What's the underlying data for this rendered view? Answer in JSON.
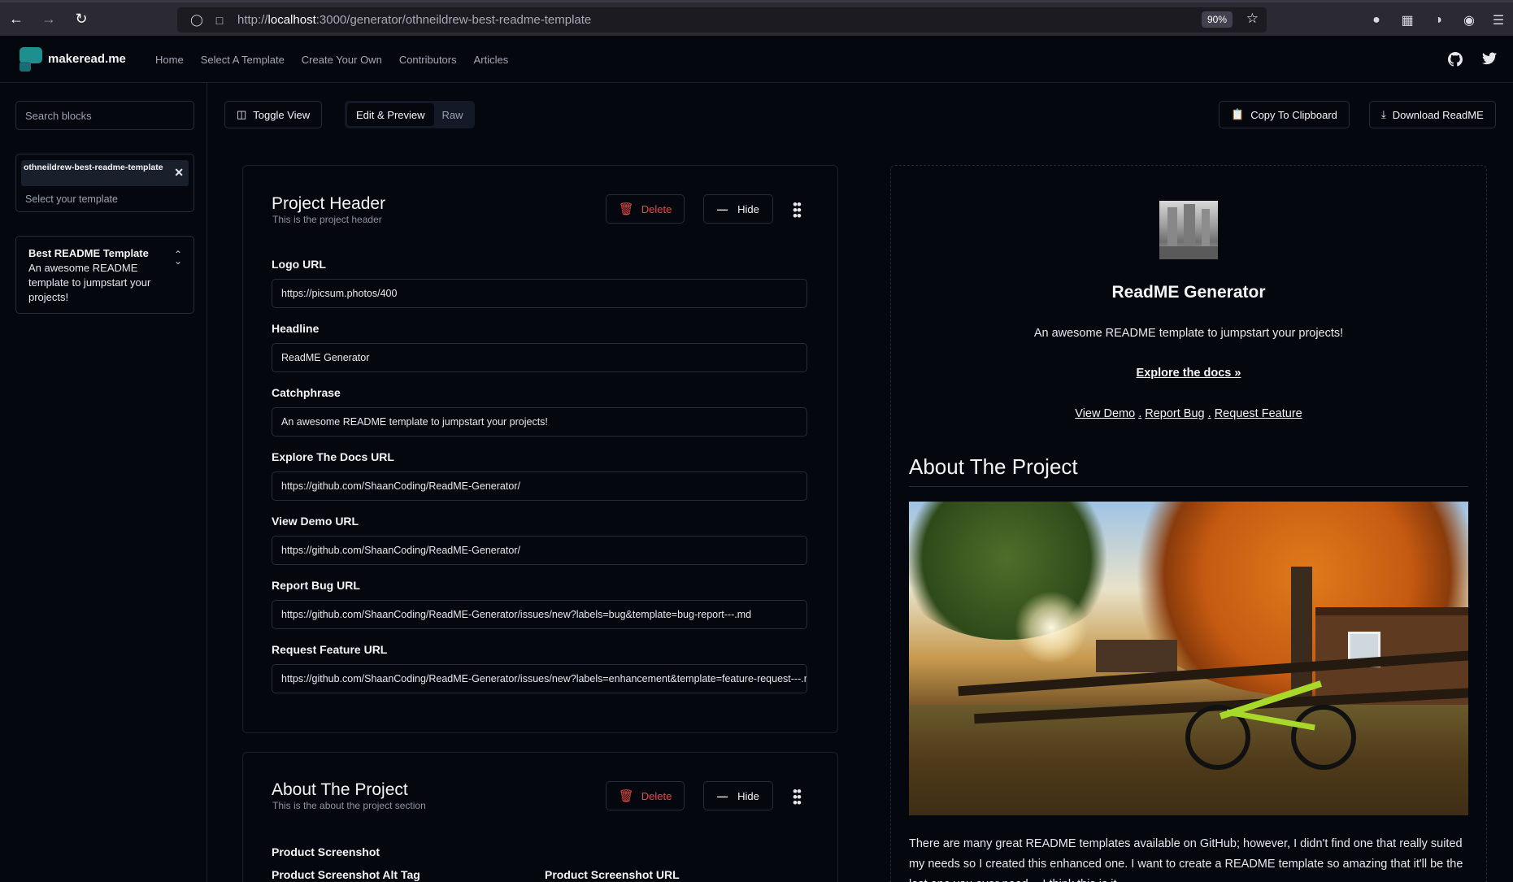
{
  "browser": {
    "url_prefix": "http://",
    "url_host": "localhost",
    "url_path": ":3000/generator/othneildrew-best-readme-template",
    "zoom": "90%"
  },
  "header": {
    "brand": "makeread.me",
    "nav": [
      "Home",
      "Select A Template",
      "Create Your Own",
      "Contributors",
      "Articles"
    ]
  },
  "sidebar": {
    "search_placeholder": "Search blocks",
    "template_chip": "othneildrew-best-readme-template",
    "template_placeholder": "Select your template",
    "block": {
      "title": "Best README Template",
      "description": "An awesome README template to jumpstart your projects!"
    }
  },
  "toolbar": {
    "toggle_view": "Toggle View",
    "mode_edit": "Edit & Preview",
    "mode_raw": "Raw",
    "copy": "Copy To Clipboard",
    "download": "Download ReadME"
  },
  "editor": {
    "delete_label": "Delete",
    "hide_label": "Hide",
    "project_header": {
      "title": "Project Header",
      "subtitle": "This is the project header",
      "fields": [
        {
          "label": "Logo URL",
          "value": "https://picsum.photos/400"
        },
        {
          "label": "Headline",
          "value": "ReadME Generator"
        },
        {
          "label": "Catchphrase",
          "value": "An awesome README template to jumpstart your projects!"
        },
        {
          "label": "Explore The Docs URL",
          "value": "https://github.com/ShaanCoding/ReadME-Generator/"
        },
        {
          "label": "View Demo URL",
          "value": "https://github.com/ShaanCoding/ReadME-Generator/"
        },
        {
          "label": "Report Bug URL",
          "value": "https://github.com/ShaanCoding/ReadME-Generator/issues/new?labels=bug&template=bug-report---.md"
        },
        {
          "label": "Request Feature URL",
          "value": "https://github.com/ShaanCoding/ReadME-Generator/issues/new?labels=enhancement&template=feature-request---.md"
        }
      ]
    },
    "about": {
      "title": "About The Project",
      "subtitle": "This is the about the project section",
      "screenshot_label": "Product Screenshot",
      "alt_label": "Product Screenshot Alt Tag",
      "url_label": "Product Screenshot URL"
    }
  },
  "preview": {
    "headline": "ReadME Generator",
    "catchphrase": "An awesome README template to jumpstart your projects!",
    "explore_docs": "Explore the docs »",
    "view_demo": "View Demo",
    "report_bug": "Report Bug",
    "request_feature": "Request Feature",
    "separator": ".",
    "about_heading": "About The Project",
    "about_text": "There are many great README templates available on GitHub; however, I didn't find one that really suited my needs so I created this enhanced one. I want to create a README template so amazing that it'll be the last one you ever need -- I think this is it."
  }
}
